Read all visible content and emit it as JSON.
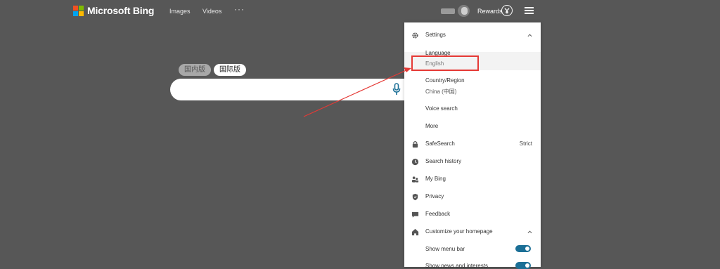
{
  "header": {
    "brand": "Microsoft Bing",
    "nav": {
      "images": "Images",
      "videos": "Videos",
      "more": "···"
    },
    "rewards": "Rewards"
  },
  "market_toggle": {
    "china": "国内版",
    "international": "国际版"
  },
  "settings_panel": {
    "settings_label": "Settings",
    "language_label": "Language",
    "language_value": "English",
    "country_label": "Country/Region",
    "country_value": "China (中国)",
    "voice_search": "Voice search",
    "more": "More",
    "safesearch_label": "SafeSearch",
    "safesearch_value": "Strict",
    "search_history": "Search history",
    "my_bing": "My Bing",
    "privacy": "Privacy",
    "feedback": "Feedback",
    "customize_label": "Customize your homepage",
    "show_menu_bar": "Show menu bar",
    "show_news": "Show news and interests",
    "show_menu_bar_on": true,
    "show_news_on": true
  },
  "colors": {
    "background": "#575757",
    "highlight_box": "#e53935",
    "toggle_on": "#1b6f96",
    "logo": [
      "#f25022",
      "#7fba00",
      "#00a4ef",
      "#ffb900"
    ]
  },
  "icons": [
    "gear-icon",
    "lock-icon",
    "clock-icon",
    "people-icon",
    "shield-icon",
    "chat-icon",
    "home-icon",
    "mic-icon",
    "rewards-icon",
    "hamburger-icon"
  ]
}
